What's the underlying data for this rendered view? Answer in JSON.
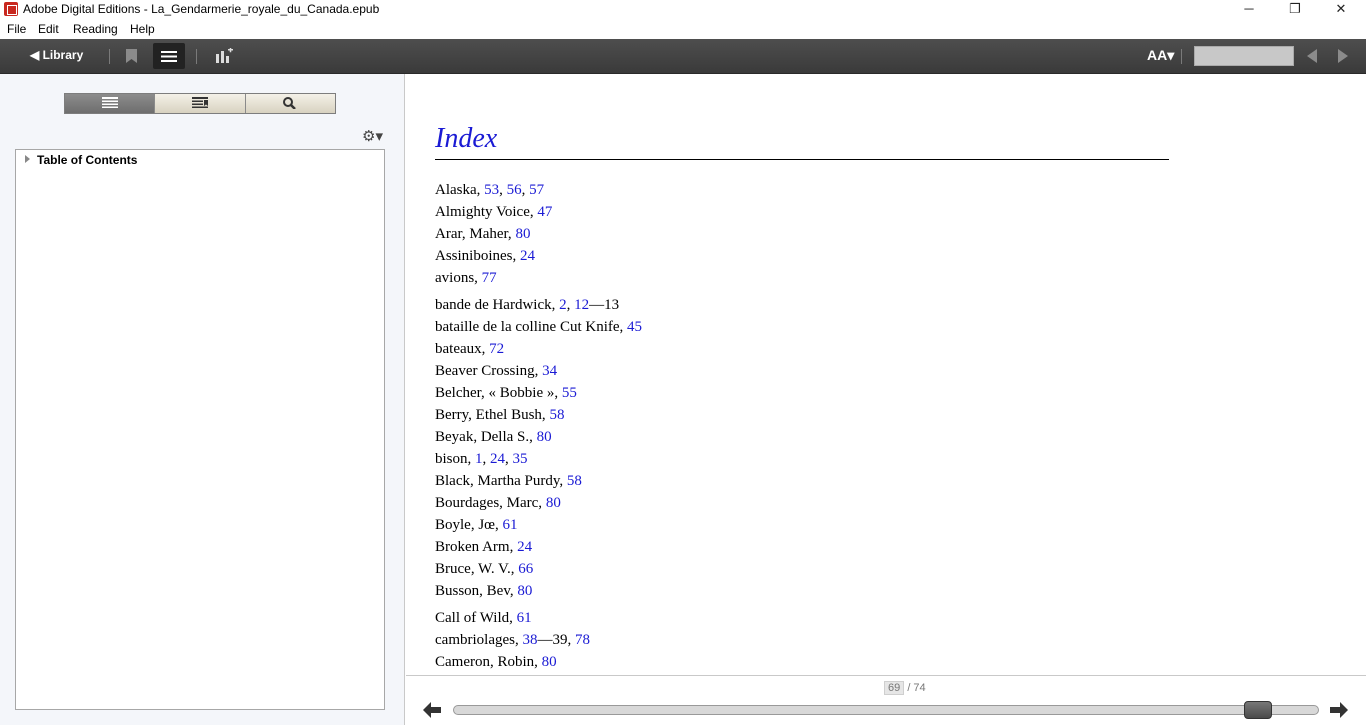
{
  "window": {
    "title": "Adobe Digital Editions - La_Gendarmerie_royale_du_Canada.epub",
    "minimize": "─",
    "restore": "❐",
    "close": "✕"
  },
  "menu": [
    "File",
    "Edit",
    "Reading",
    "Help"
  ],
  "toolbar": {
    "library_label": "◀ Library",
    "bookmark_icon": "bookmark-icon",
    "toc_icon": "list-icon",
    "stats_icon": "chart-add-icon",
    "font_size_label": "AA▾",
    "page_field_value": ""
  },
  "sidebar": {
    "tabs": [
      {
        "name": "toc-tab",
        "icon": "list-icon"
      },
      {
        "name": "bookmarks-tab",
        "icon": "bookmark-list-icon"
      },
      {
        "name": "search-tab",
        "icon": "search-icon"
      }
    ],
    "settings_icon": "gear-icon",
    "toc_root": "Table of Contents"
  },
  "reader": {
    "heading": "Index",
    "entries": [
      {
        "text": "Alaska, ",
        "links": [
          [
            "53",
            ", "
          ],
          [
            "56",
            ", "
          ],
          [
            "57",
            ""
          ]
        ],
        "tail": ""
      },
      {
        "text": "Almighty Voice, ",
        "links": [
          [
            "47",
            ""
          ]
        ],
        "tail": ""
      },
      {
        "text": "Arar, Maher, ",
        "links": [
          [
            "80",
            ""
          ]
        ],
        "tail": ""
      },
      {
        "text": "Assiniboines, ",
        "links": [
          [
            "24",
            ""
          ]
        ],
        "tail": ""
      },
      {
        "text": "avions, ",
        "links": [
          [
            "77",
            ""
          ]
        ],
        "tail": ""
      },
      {
        "text": "bande de Hardwick, ",
        "links": [
          [
            "2",
            ", "
          ],
          [
            "12",
            ""
          ]
        ],
        "tail": "—13"
      },
      {
        "text": "bataille de la colline Cut Knife, ",
        "links": [
          [
            "45",
            ""
          ]
        ],
        "tail": ""
      },
      {
        "text": "bateaux, ",
        "links": [
          [
            "72",
            ""
          ]
        ],
        "tail": ""
      },
      {
        "text": "Beaver Crossing, ",
        "links": [
          [
            "34",
            ""
          ]
        ],
        "tail": ""
      },
      {
        "text": "Belcher, « Bobbie », ",
        "links": [
          [
            "55",
            ""
          ]
        ],
        "tail": ""
      },
      {
        "text": "Berry, Ethel Bush, ",
        "links": [
          [
            "58",
            ""
          ]
        ],
        "tail": ""
      },
      {
        "text": "Beyak, Della S., ",
        "links": [
          [
            "80",
            ""
          ]
        ],
        "tail": ""
      },
      {
        "text": "bison, ",
        "links": [
          [
            "1",
            ", "
          ],
          [
            "24",
            ", "
          ],
          [
            "35",
            ""
          ]
        ],
        "tail": ""
      },
      {
        "text": "Black, Martha Purdy, ",
        "links": [
          [
            "58",
            ""
          ]
        ],
        "tail": ""
      },
      {
        "text": "Bourdages, Marc, ",
        "links": [
          [
            "80",
            ""
          ]
        ],
        "tail": ""
      },
      {
        "text": "Boyle, Jœ, ",
        "links": [
          [
            "61",
            ""
          ]
        ],
        "tail": ""
      },
      {
        "text": "Broken Arm, ",
        "links": [
          [
            "24",
            ""
          ]
        ],
        "tail": ""
      },
      {
        "text": "Bruce, W. V., ",
        "links": [
          [
            "66",
            ""
          ]
        ],
        "tail": ""
      },
      {
        "text": "Busson, Bev, ",
        "links": [
          [
            "80",
            ""
          ]
        ],
        "tail": ""
      },
      {
        "text": "Call of Wild, ",
        "links": [
          [
            "61",
            ""
          ]
        ],
        "tail": ""
      },
      {
        "text": "cambriolages, ",
        "links": [
          [
            "38",
            "—39, "
          ],
          [
            "78",
            ""
          ]
        ],
        "tail": ""
      },
      {
        "text": "Cameron, Robin, ",
        "links": [
          [
            "80",
            ""
          ]
        ],
        "tail": ""
      }
    ]
  },
  "footer": {
    "current_page": "69",
    "total_pages": "/ 74",
    "progress_fraction": 0.93,
    "prev_icon": "arrow-left-icon",
    "next_icon": "arrow-right-icon"
  },
  "colors": {
    "link": "#1a1ad4",
    "toolbar": "#444444",
    "sidebar_bg": "#f4f6fa"
  }
}
